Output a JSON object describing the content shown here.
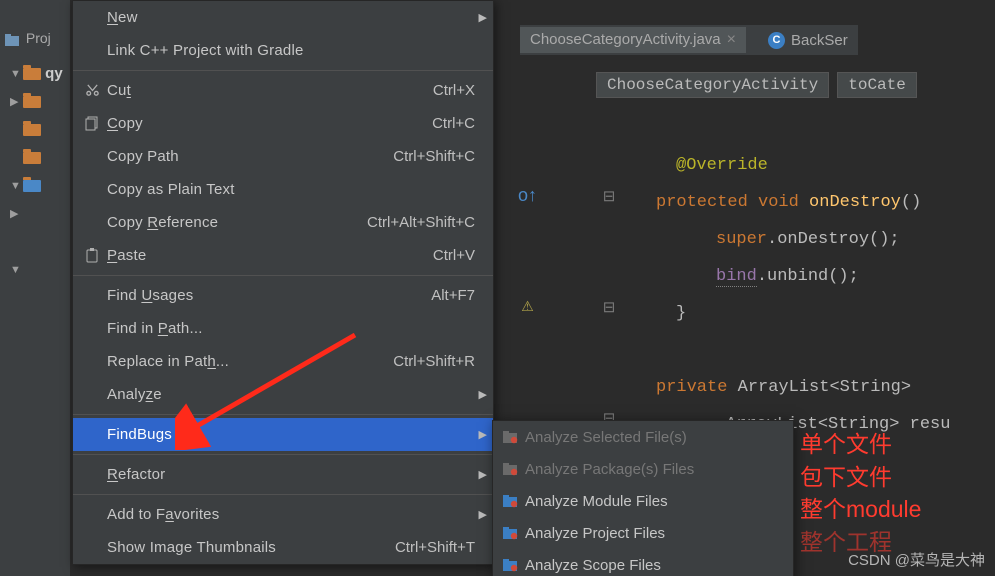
{
  "project": {
    "tab_label": "Proj",
    "tree_root": "qy"
  },
  "editor_tabs": [
    {
      "label": "ChooseCategoryActivity.java",
      "kind": "java"
    },
    {
      "label": "BackSer",
      "kind": "class"
    }
  ],
  "breadcrumbs": [
    "ChooseCategoryActivity",
    "toCate"
  ],
  "code": {
    "l1_ann": "@Override",
    "l2_kw1": "protected",
    "l2_kw2": "void",
    "l2_fn": "onDestroy",
    "l2_tail": "()",
    "l3_kw": "super",
    "l3_rest": ".onDestroy();",
    "l4_id": "bind",
    "l4_call": ".unbind();",
    "l5": "}",
    "l6_kw": "private",
    "l6_ty": "ArrayList<String>",
    "l7_ty": "ArrayList<String>",
    "l7_var": " resu"
  },
  "context_menu": [
    {
      "label_pre": "",
      "u": "N",
      "label_post": "ew",
      "shortcut": "",
      "submenu": true,
      "icon": ""
    },
    {
      "label_pre": "Link C++ Project with Gradle",
      "u": "",
      "label_post": "",
      "shortcut": "",
      "icon": ""
    },
    {
      "sep": true
    },
    {
      "label_pre": "Cu",
      "u": "t",
      "label_post": "",
      "shortcut": "Ctrl+X",
      "icon": "cut"
    },
    {
      "label_pre": "",
      "u": "C",
      "label_post": "opy",
      "shortcut": "Ctrl+C",
      "icon": "copy"
    },
    {
      "label_pre": "Copy Path",
      "u": "",
      "label_post": "",
      "shortcut": "Ctrl+Shift+C",
      "icon": ""
    },
    {
      "label_pre": "Copy as Plain Text",
      "u": "",
      "label_post": "",
      "shortcut": "",
      "icon": ""
    },
    {
      "label_pre": "Copy ",
      "u": "R",
      "label_post": "eference",
      "shortcut": "Ctrl+Alt+Shift+C",
      "icon": ""
    },
    {
      "label_pre": "",
      "u": "P",
      "label_post": "aste",
      "shortcut": "Ctrl+V",
      "icon": "paste"
    },
    {
      "sep": true
    },
    {
      "label_pre": "Find ",
      "u": "U",
      "label_post": "sages",
      "shortcut": "Alt+F7",
      "icon": ""
    },
    {
      "label_pre": "Find in ",
      "u": "P",
      "label_post": "ath...",
      "shortcut": "",
      "icon": ""
    },
    {
      "label_pre": "Replace in Pat",
      "u": "h",
      "label_post": "...",
      "shortcut": "Ctrl+Shift+R",
      "icon": ""
    },
    {
      "label_pre": "Analy",
      "u": "z",
      "label_post": "e",
      "shortcut": "",
      "submenu": true,
      "icon": ""
    },
    {
      "sep": true
    },
    {
      "label_pre": "FindBugs",
      "u": "",
      "label_post": "",
      "shortcut": "",
      "submenu": true,
      "hl": true,
      "icon": ""
    },
    {
      "sep": true
    },
    {
      "label_pre": "",
      "u": "R",
      "label_post": "efactor",
      "shortcut": "",
      "submenu": true,
      "icon": ""
    },
    {
      "sep": true
    },
    {
      "label_pre": "Add to F",
      "u": "a",
      "label_post": "vorites",
      "shortcut": "",
      "submenu": true,
      "icon": ""
    },
    {
      "label_pre": "Show Image Thumbnails",
      "u": "",
      "label_post": "",
      "shortcut": "Ctrl+Shift+T",
      "icon": ""
    }
  ],
  "submenu": [
    {
      "label": "Analyze Selected File(s)",
      "dis": true,
      "icon": "file"
    },
    {
      "label": "Analyze Package(s) Files",
      "dis": true,
      "icon": "pkg"
    },
    {
      "label": "Analyze Module Files",
      "dis": false,
      "icon": "module"
    },
    {
      "label": "Analyze Project Files",
      "dis": false,
      "icon": "project"
    },
    {
      "label": "Analyze Scope Files",
      "dis": false,
      "icon": "scope"
    }
  ],
  "annotations": {
    "a1": "单个文件",
    "a2": "包下文件",
    "a3": "整个module",
    "a4": "整个工程"
  },
  "watermark": "CSDN @菜鸟是大神"
}
